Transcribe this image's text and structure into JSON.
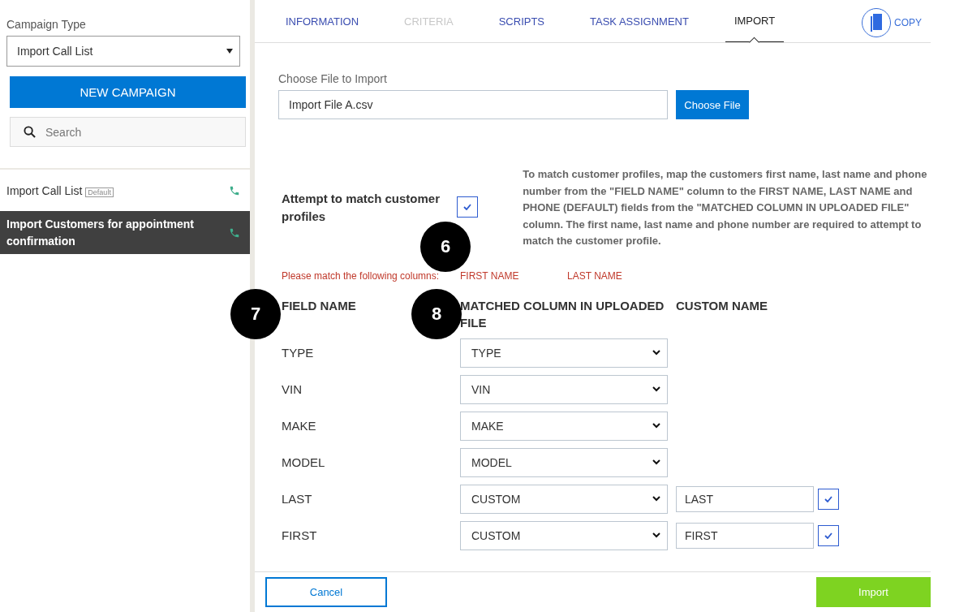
{
  "sidebar": {
    "campaign_type_label": "Campaign Type",
    "campaign_type_value": "Import Call List",
    "new_campaign_button": "NEW CAMPAIGN",
    "search_placeholder": "Search",
    "campaigns": [
      {
        "name": "Import Call List",
        "badge": "Default",
        "selected": false
      },
      {
        "name": "Import Customers for appointment confirmation",
        "selected": true
      }
    ]
  },
  "tabs": [
    {
      "label": "INFORMATION",
      "selected": false,
      "disabled": false
    },
    {
      "label": "CRITERIA",
      "selected": false,
      "disabled": true
    },
    {
      "label": "SCRIPTS",
      "selected": false,
      "disabled": false
    },
    {
      "label": "TASK ASSIGNMENT",
      "selected": false,
      "disabled": false
    },
    {
      "label": "IMPORT",
      "selected": true,
      "disabled": false
    }
  ],
  "copy_button": "COPY",
  "file": {
    "label": "Choose File to Import",
    "value": "Import File A.csv",
    "button": "Choose File"
  },
  "match": {
    "label": "Attempt to match customer profiles",
    "checked": true,
    "description": "To match customer profiles, map the customers first name, last name and phone number from the \"FIELD NAME\" column to the FIRST NAME, LAST NAME and PHONE (DEFAULT) fields from the \"MATCHED COLUMN IN UPLOADED FILE\" column. The first name, last name and phone number are required to attempt to match the customer profile."
  },
  "warning": {
    "label": "Please match the following columns:",
    "columns": [
      "FIRST NAME",
      "LAST NAME"
    ]
  },
  "mapping": {
    "columns": [
      "FIELD NAME",
      "MATCHED COLUMN IN UPLOADED FILE",
      "CUSTOM NAME"
    ],
    "rows": [
      {
        "kind": "standard",
        "field": "TYPE",
        "matched": "TYPE"
      },
      {
        "kind": "standard",
        "field": "VIN",
        "matched": "VIN"
      },
      {
        "kind": "standard",
        "field": "MAKE",
        "matched": "MAKE"
      },
      {
        "kind": "standard",
        "field": "MODEL",
        "matched": "MODEL"
      },
      {
        "kind": "custom",
        "field": "LAST",
        "matched": "CUSTOM",
        "custom": "LAST",
        "checked": true
      },
      {
        "kind": "custom",
        "field": "FIRST",
        "matched": "CUSTOM",
        "custom": "FIRST",
        "checked": true
      }
    ]
  },
  "callouts": [
    "6",
    "7",
    "8"
  ],
  "footer": {
    "cancel": "Cancel",
    "import": "Import"
  }
}
